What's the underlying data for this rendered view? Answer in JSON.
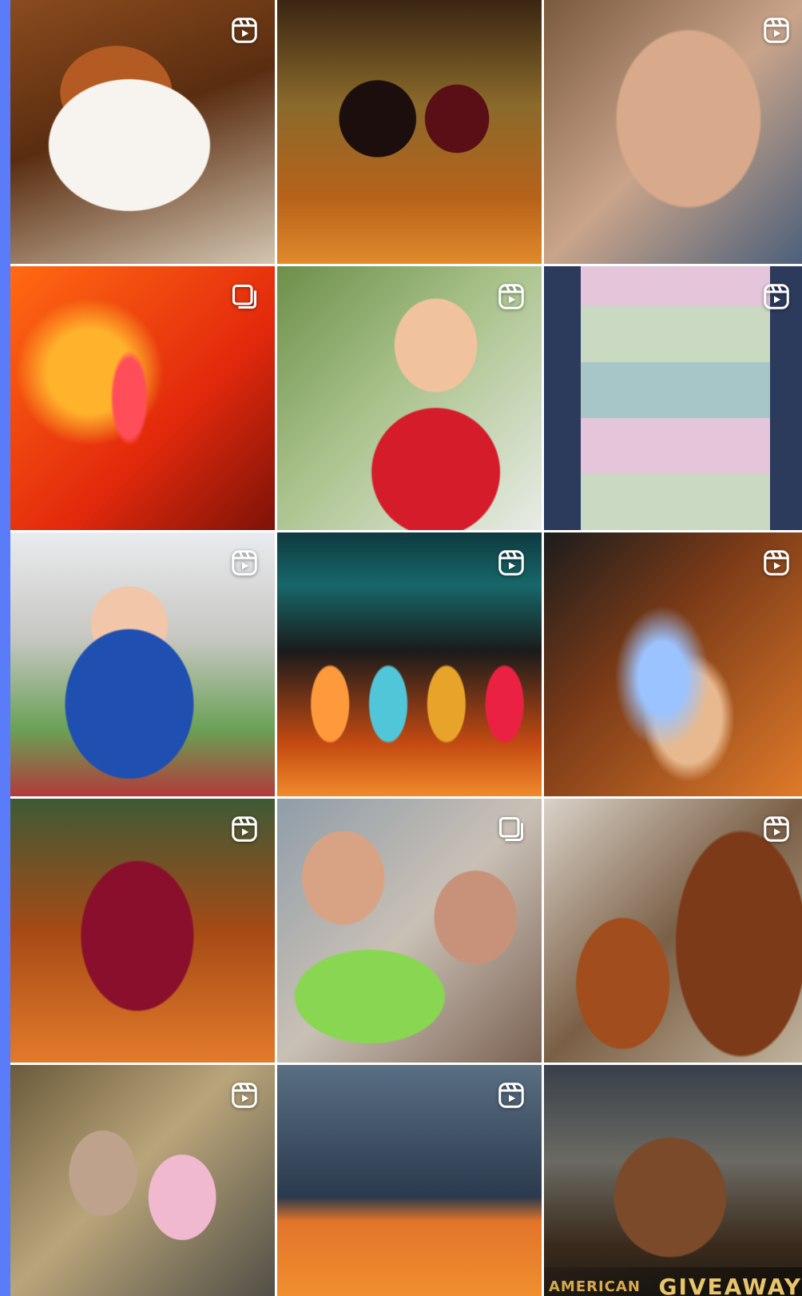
{
  "colors": {
    "accent_bar": "#5b7cf8",
    "badge": "#ffffff"
  },
  "grid": {
    "columns": 3,
    "tiles": [
      {
        "index": 1,
        "badge_icon": "reel-icon"
      },
      {
        "index": 2,
        "badge_icon": "none"
      },
      {
        "index": 3,
        "badge_icon": "reel-icon"
      },
      {
        "index": 4,
        "badge_icon": "carousel-icon"
      },
      {
        "index": 5,
        "badge_icon": "reel-icon"
      },
      {
        "index": 6,
        "badge_icon": "reel-icon"
      },
      {
        "index": 7,
        "badge_icon": "reel-icon"
      },
      {
        "index": 8,
        "badge_icon": "reel-icon"
      },
      {
        "index": 9,
        "badge_icon": "reel-icon"
      },
      {
        "index": 10,
        "badge_icon": "reel-icon"
      },
      {
        "index": 11,
        "badge_icon": "carousel-icon"
      },
      {
        "index": 12,
        "badge_icon": "reel-icon"
      },
      {
        "index": 13,
        "badge_icon": "reel-icon"
      },
      {
        "index": 14,
        "badge_icon": "reel-icon"
      },
      {
        "index": 15,
        "badge_icon": "none"
      }
    ],
    "tile15": {
      "brand": "AMERICAN",
      "word": "GIVEAWAY"
    }
  }
}
